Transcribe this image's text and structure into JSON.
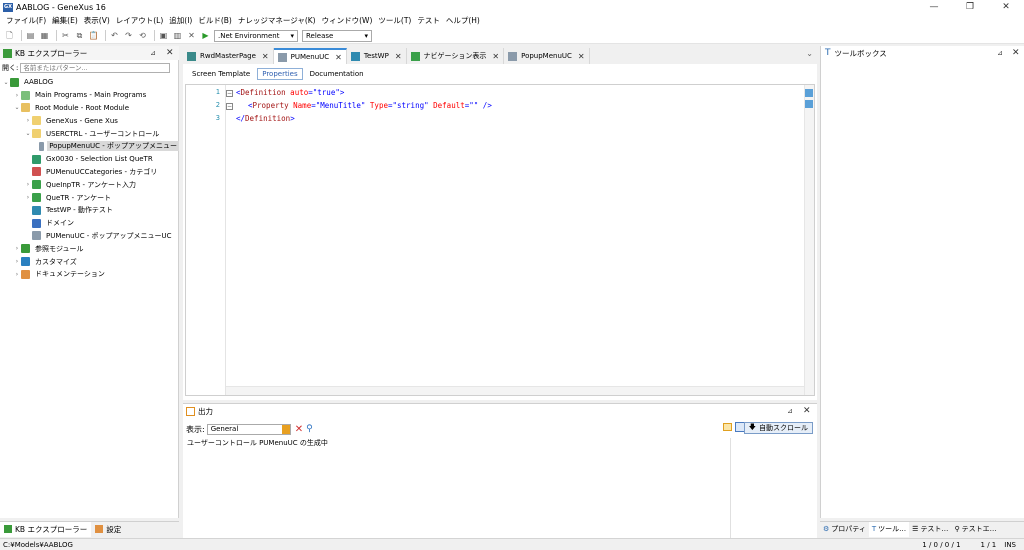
{
  "window": {
    "icon": "GX",
    "title": "AABLOG - GeneXus 16",
    "minimize": "—",
    "restore": "❐",
    "close": "✕"
  },
  "menubar": {
    "items": [
      "ファイル(F)",
      "編集(E)",
      "表示(V)",
      "レイアウト(L)",
      "追加(I)",
      "ビルド(B)",
      "ナレッジマネージャ(K)",
      "ウィンドウ(W)",
      "ツール(T)",
      "テスト",
      "ヘルプ(H)"
    ]
  },
  "toolbar": {
    "environment": ".Net Environment",
    "configuration": "Release"
  },
  "kb_explorer": {
    "title": "KB エクスプローラー",
    "search_label": "開く:",
    "search_placeholder": "名前またはパターン...",
    "tree": [
      {
        "label": "AABLOG",
        "level": 0,
        "expanded": true,
        "icon_color": "#3a9a3a"
      },
      {
        "label": "Main Programs - Main Programs",
        "level": 1,
        "expanded": false,
        "icon_color": "#7bbf7b"
      },
      {
        "label": "Root Module - Root Module",
        "level": 1,
        "expanded": true,
        "icon_color": "#e8c060"
      },
      {
        "label": "GeneXus - Gene Xus",
        "level": 2,
        "expanded": false,
        "icon_color": "#f0d070"
      },
      {
        "label": "USERCTRL - ユーザーコントロール",
        "level": 2,
        "expanded": true,
        "icon_color": "#f0d070"
      },
      {
        "label": "PopupMenuUC - ポップアップメニュー",
        "level": 3,
        "expanded": null,
        "icon_color": "#8a9aaa",
        "selected": true
      },
      {
        "label": "Gx0030 - Selection List QueTR",
        "level": 2,
        "expanded": null,
        "icon_color": "#2f9a6a"
      },
      {
        "label": "PUMenuUCCategories - カテゴリ",
        "level": 2,
        "expanded": null,
        "icon_color": "#d05050"
      },
      {
        "label": "QueInpTR - アンケート入力",
        "level": 2,
        "expanded": false,
        "icon_color": "#3aa04a"
      },
      {
        "label": "QueTR - アンケート",
        "level": 2,
        "expanded": false,
        "icon_color": "#3aa04a"
      },
      {
        "label": "TestWP - 動作テスト",
        "level": 2,
        "expanded": null,
        "icon_color": "#2f8ab0"
      },
      {
        "label": "ドメイン",
        "level": 2,
        "expanded": null,
        "icon_color": "#3a70c0"
      },
      {
        "label": "PUMenuUC - ポップアップメニューUC",
        "level": 2,
        "expanded": null,
        "icon_color": "#8a9aaa"
      },
      {
        "label": "参照モジュール",
        "level": 1,
        "expanded": false,
        "icon_color": "#3a9a3a"
      },
      {
        "label": "カスタマイズ",
        "level": 1,
        "expanded": false,
        "icon_color": "#2a80c0"
      },
      {
        "label": "ドキュメンテーション",
        "level": 1,
        "expanded": false,
        "icon_color": "#e09040"
      }
    ],
    "bottom_tabs": [
      "KB エクスプローラー",
      "設定"
    ]
  },
  "doc_tabs": [
    {
      "label": "RwdMasterPage",
      "active": false,
      "icon_color": "#3a8a8a"
    },
    {
      "label": "PUMenuUC",
      "active": true,
      "icon_color": "#8a9aaa"
    },
    {
      "label": "TestWP",
      "active": false,
      "icon_color": "#2f8ab0"
    },
    {
      "label": "ナビゲーション表示",
      "active": false,
      "icon_color": "#3aa04a"
    },
    {
      "label": "PopupMenuUC",
      "active": false,
      "icon_color": "#8a9aaa"
    }
  ],
  "sub_tabs": [
    {
      "label": "Screen Template",
      "active": false
    },
    {
      "label": "Properties",
      "active": true
    },
    {
      "label": "Documentation",
      "active": false
    }
  ],
  "editor": {
    "line_numbers": [
      "1",
      "2",
      "3"
    ],
    "line1": {
      "open": "<",
      "tag": "Definition",
      "attr": " auto",
      "eq": "=",
      "val": "\"true\"",
      "close": ">"
    },
    "line2": {
      "open": "<",
      "tag": "Property",
      "a1": " Name",
      "eq1": "=",
      "v1": "\"MenuTitle\"",
      "a2": " Type",
      "eq2": "=",
      "v2": "\"string\"",
      "a3": " Default",
      "eq3": "=",
      "v3": "\"\"",
      "close": " />"
    },
    "line3": {
      "open": "</",
      "tag": "Definition",
      "close": ">"
    }
  },
  "output": {
    "title": "出力",
    "filter_label": "表示:",
    "filter_value": "General",
    "autoscroll_label": "自動スクロール",
    "log": "ユーザーコントロール PUMenuUC の生成中"
  },
  "toolbox": {
    "title": "ツールボックス",
    "bottom_tabs": [
      "プロパティ",
      "ツール…",
      "テスト…",
      "テストエ…"
    ]
  },
  "statusbar": {
    "path": "C:¥Models¥AABLOG",
    "counts": "1 / 0 / 0 / 1",
    "position": "1 / 1",
    "mode": "INS"
  }
}
